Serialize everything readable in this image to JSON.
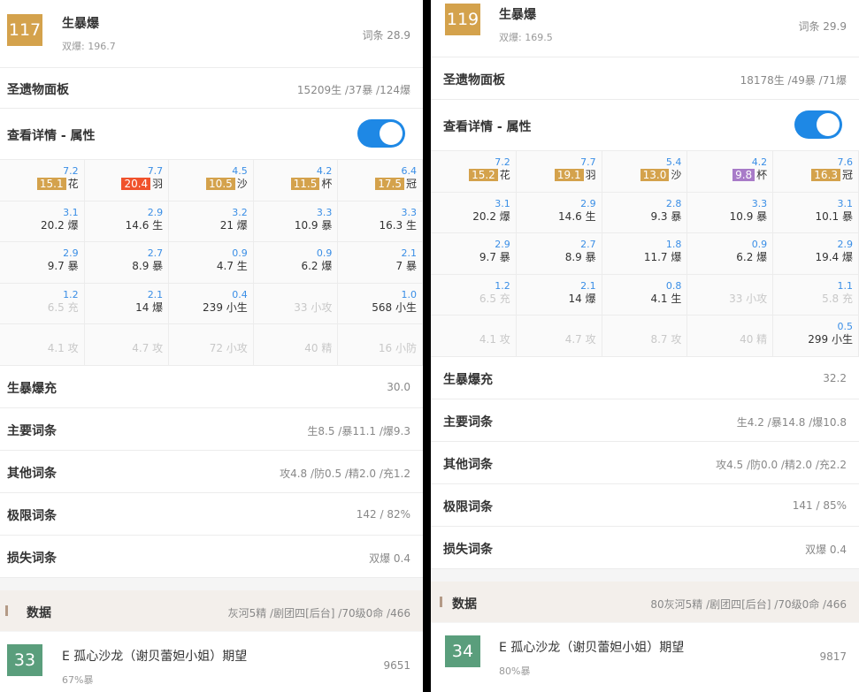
{
  "panels": [
    {
      "top_item": {
        "level": "117",
        "name": "生暴爆",
        "sub": "双爆: 196.7",
        "right": "词条 28.9",
        "badge_color": "#d4a24c"
      },
      "relic": {
        "label": "圣遗物面板",
        "value": "15209生 /37暴 /124爆"
      },
      "details": {
        "label": "查看详情 - 属性"
      },
      "grid": [
        [
          {
            "s": "7.2",
            "m": "花",
            "chip": "15.1",
            "chip_color": "#d4a24c"
          },
          {
            "s": "7.7",
            "m": "羽",
            "chip": "20.4",
            "chip_color": "#f0522c"
          },
          {
            "s": "4.5",
            "m": "沙",
            "chip": "10.5",
            "chip_color": "#d4a24c"
          },
          {
            "s": "4.2",
            "m": "杯",
            "chip": "11.5",
            "chip_color": "#d4a24c"
          },
          {
            "s": "6.4",
            "m": "冠",
            "chip": "17.5",
            "chip_color": "#d4a24c"
          }
        ],
        [
          {
            "s": "3.1",
            "m": "20.2 爆"
          },
          {
            "s": "2.9",
            "m": "14.6 生"
          },
          {
            "s": "3.2",
            "m": "21 爆"
          },
          {
            "s": "3.3",
            "m": "10.9 暴"
          },
          {
            "s": "3.3",
            "m": "16.3 生"
          }
        ],
        [
          {
            "s": "2.9",
            "m": "9.7 暴"
          },
          {
            "s": "2.7",
            "m": "8.9 暴"
          },
          {
            "s": "0.9",
            "m": "4.7 生"
          },
          {
            "s": "0.9",
            "m": "6.2 爆"
          },
          {
            "s": "2.1",
            "m": "7 暴"
          }
        ],
        [
          {
            "s": "1.2",
            "m": "6.5 充",
            "dim": true
          },
          {
            "s": "2.1",
            "m": "14 爆"
          },
          {
            "s": "0.4",
            "m": "239 小生"
          },
          {
            "s": "",
            "m": "33 小攻",
            "dim": true
          },
          {
            "s": "1.0",
            "m": "568 小生"
          }
        ],
        [
          {
            "s": "",
            "m": "4.1 攻",
            "dim": true
          },
          {
            "s": "",
            "m": "4.7 攻",
            "dim": true
          },
          {
            "s": "",
            "m": "72 小攻",
            "dim": true
          },
          {
            "s": "",
            "m": "40 精",
            "dim": true
          },
          {
            "s": "",
            "m": "16 小防",
            "dim": true
          }
        ]
      ],
      "stats": [
        {
          "label": "生暴爆充",
          "value": "30.0"
        },
        {
          "label": "主要词条",
          "value": "生8.5 /暴11.1 /爆9.3"
        },
        {
          "label": "其他词条",
          "value": "攻4.8 /防0.5 /精2.0 /充1.2"
        },
        {
          "label": "极限词条",
          "value": "142 / 82%"
        },
        {
          "label": "损失词条",
          "value": "双爆 0.4"
        }
      ],
      "section": {
        "label": "数据",
        "value": "灰河5精 /剧团四[后台] /70级0命 /466"
      },
      "bottom_item": {
        "level": "33",
        "name": "E 孤心沙龙（谢贝蕾妲小姐）期望",
        "sub": "67%暴",
        "right": "9651",
        "badge_color": "#5a9e7c"
      }
    },
    {
      "top_item": {
        "level": "119",
        "name": "生暴爆",
        "sub": "双爆: 169.5",
        "right": "词条 29.9",
        "badge_color": "#d4a24c"
      },
      "relic": {
        "label": "圣遗物面板",
        "value": "18178生 /49暴 /71爆"
      },
      "details": {
        "label": "查看详情 - 属性"
      },
      "grid": [
        [
          {
            "s": "7.2",
            "m": "花",
            "chip": "15.2",
            "chip_color": "#d4a24c"
          },
          {
            "s": "7.7",
            "m": "羽",
            "chip": "19.1",
            "chip_color": "#d4a24c"
          },
          {
            "s": "5.4",
            "m": "沙",
            "chip": "13.0",
            "chip_color": "#d4a24c"
          },
          {
            "s": "4.2",
            "m": "杯",
            "chip": "9.8",
            "chip_color": "#a87bc8"
          },
          {
            "s": "7.6",
            "m": "冠",
            "chip": "16.3",
            "chip_color": "#d4a24c"
          }
        ],
        [
          {
            "s": "3.1",
            "m": "20.2 爆"
          },
          {
            "s": "2.9",
            "m": "14.6 生"
          },
          {
            "s": "2.8",
            "m": "9.3 暴"
          },
          {
            "s": "3.3",
            "m": "10.9 暴"
          },
          {
            "s": "3.1",
            "m": "10.1 暴"
          }
        ],
        [
          {
            "s": "2.9",
            "m": "9.7 暴"
          },
          {
            "s": "2.7",
            "m": "8.9 暴"
          },
          {
            "s": "1.8",
            "m": "11.7 爆"
          },
          {
            "s": "0.9",
            "m": "6.2 爆"
          },
          {
            "s": "2.9",
            "m": "19.4 爆"
          }
        ],
        [
          {
            "s": "1.2",
            "m": "6.5 充",
            "dim": true
          },
          {
            "s": "2.1",
            "m": "14 爆"
          },
          {
            "s": "0.8",
            "m": "4.1 生"
          },
          {
            "s": "",
            "m": "33 小攻",
            "dim": true
          },
          {
            "s": "1.1",
            "m": "5.8 充",
            "dim": true
          }
        ],
        [
          {
            "s": "",
            "m": "4.1 攻",
            "dim": true
          },
          {
            "s": "",
            "m": "4.7 攻",
            "dim": true
          },
          {
            "s": "",
            "m": "8.7 攻",
            "dim": true
          },
          {
            "s": "",
            "m": "40 精",
            "dim": true
          },
          {
            "s": "0.5",
            "m": "299 小生"
          }
        ]
      ],
      "stats": [
        {
          "label": "生暴爆充",
          "value": "32.2"
        },
        {
          "label": "主要词条",
          "value": "生4.2 /暴14.8 /爆10.8"
        },
        {
          "label": "其他词条",
          "value": "攻4.5 /防0.0 /精2.0 /充2.2"
        },
        {
          "label": "极限词条",
          "value": "141 / 85%"
        },
        {
          "label": "损失词条",
          "value": "双爆 0.4"
        }
      ],
      "section": {
        "label": "数据",
        "value": "80灰河5精 /剧团四[后台] /70级0命 /466"
      },
      "bottom_item": {
        "level": "34",
        "name": "E 孤心沙龙（谢贝蕾妲小姐）期望",
        "sub": "80%暴",
        "right": "9817",
        "badge_color": "#5a9e7c"
      }
    }
  ]
}
